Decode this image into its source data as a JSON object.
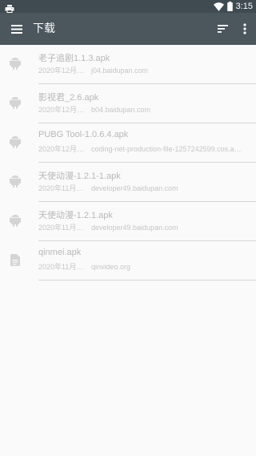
{
  "status_bar": {
    "time": "3:15",
    "left_icon": "print-icon",
    "right_icons": [
      "wifi-icon",
      "battery-icon"
    ]
  },
  "app_bar": {
    "title": "下载",
    "menu_icon": "menu-icon",
    "sort_icon": "sort-icon",
    "more_icon": "more-vert-icon"
  },
  "downloads": [
    {
      "icon": "android-icon",
      "name": "老子追剧1.1.3.apk",
      "date": "2020年12月…",
      "host": "j04.baidupan.com"
    },
    {
      "icon": "android-icon",
      "name": "影视君_2.6.apk",
      "date": "2020年12月…",
      "host": "b04.baidupan.com"
    },
    {
      "icon": "android-icon",
      "name": "PUBG Tool-1.0.6.4.apk",
      "date": "2020年12月…",
      "host": "coding-net-production-file-1257242599.cos.a…"
    },
    {
      "icon": "android-icon",
      "name": "天使动漫-1.2.1-1.apk",
      "date": "2020年11月…",
      "host": "developer49.baidupan.com"
    },
    {
      "icon": "android-icon",
      "name": "天使动漫-1.2.1.apk",
      "date": "2020年11月…",
      "host": "developer49.baidupan.com"
    },
    {
      "icon": "file-icon",
      "name": "qinmei.apk",
      "date": "2020年11月…",
      "host": "qinvideo.org"
    }
  ],
  "colors": {
    "status_bar": "#3f4a51",
    "app_bar": "#4b565d",
    "background": "#fafafa",
    "text_primary": "#b8b8b8",
    "text_secondary": "#c6c6c6",
    "icon": "#d4d4d4"
  }
}
